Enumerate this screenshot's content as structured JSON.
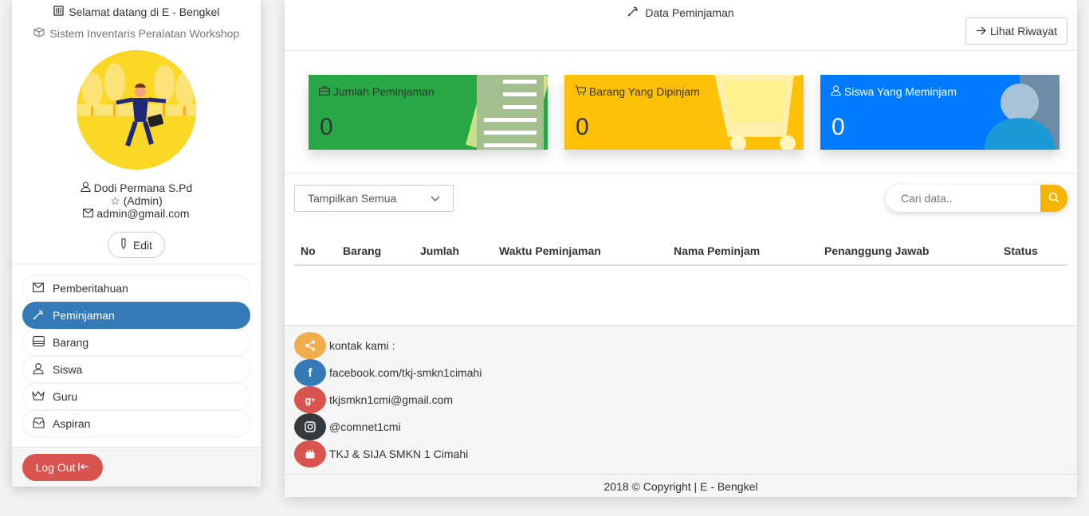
{
  "sidebar": {
    "welcome": "Selamat datang di E - Bengkel",
    "subtitle": "Sistem Inventaris Peralatan Workshop",
    "user": {
      "name": "Dodi Permana S.Pd",
      "role": "(Admin)",
      "email": "admin@gmail.com"
    },
    "edit_label": "Edit",
    "menu": [
      {
        "label": "Pemberitahuan",
        "icon": "envelope-icon",
        "active": false
      },
      {
        "label": "Peminjaman",
        "icon": "tools-icon",
        "active": true
      },
      {
        "label": "Barang",
        "icon": "hdd-icon",
        "active": false
      },
      {
        "label": "Siswa",
        "icon": "user-icon",
        "active": false
      },
      {
        "label": "Guru",
        "icon": "crown-icon",
        "active": false
      },
      {
        "label": "Aspiran",
        "icon": "inbox-icon",
        "active": false
      }
    ],
    "logout_label": "Log Out"
  },
  "main": {
    "title": "Data Peminjaman",
    "history_button": "Lihat Riwayat",
    "cards": [
      {
        "label": "Jumlah Peminjaman",
        "value": "0",
        "color": "#28a745"
      },
      {
        "label": "Barang Yang Dipinjam",
        "value": "0",
        "color": "#ffc107"
      },
      {
        "label": "Siswa Yang Meminjam",
        "value": "0",
        "color": "#007bff"
      }
    ],
    "filter": {
      "selected": "Tampilkan Semua"
    },
    "search": {
      "placeholder": "Cari data.."
    },
    "table": {
      "columns": [
        "No",
        "Barang",
        "Jumlah",
        "Waktu Peminjaman",
        "Nama Peminjam",
        "Penanggung Jawab",
        "Status"
      ],
      "rows": []
    },
    "footer": {
      "contacts": [
        {
          "text": "kontak kami :",
          "icon": "share-icon",
          "color": "#f0ad4e"
        },
        {
          "text": "facebook.com/tkj-smkn1cimahi",
          "icon": "facebook-icon",
          "color": "#337ab7"
        },
        {
          "text": "tkjsmkn1cmi@gmail.com",
          "icon": "google-plus-icon",
          "color": "#d9534f"
        },
        {
          "text": "@comnet1cmi",
          "icon": "instagram-icon",
          "color": "#333a40"
        },
        {
          "text": "TKJ & SIJA SMKN 1 Cimahi",
          "icon": "youtube-icon",
          "color": "#d9534f"
        }
      ],
      "copyright": "2018 © Copyright | E - Bengkel"
    }
  }
}
